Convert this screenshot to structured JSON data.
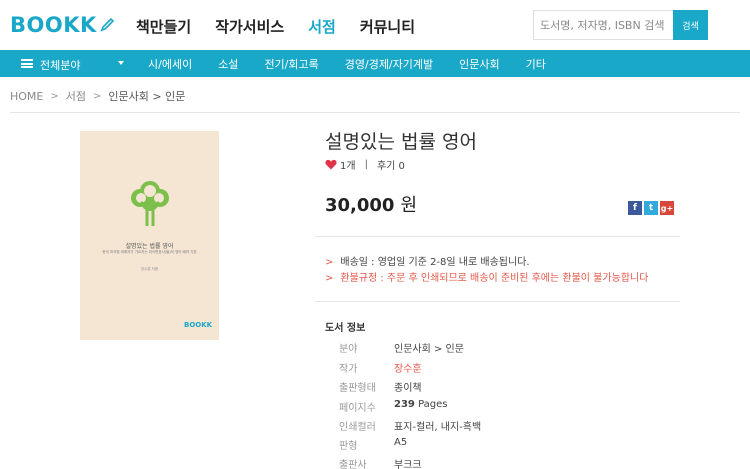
{
  "header": {
    "logo": "BOOKK",
    "nav": [
      "책만들기",
      "작가서비스",
      "서점",
      "커뮤니티"
    ],
    "active_nav": "서점",
    "search_placeholder": "도서명, 저자명, ISBN 검색",
    "search_button": "검색"
  },
  "category_bar": {
    "all_label": "전체분야",
    "items": [
      "시/에세이",
      "소설",
      "전기/회고록",
      "경영/경제/자기계발",
      "인문사회",
      "기타"
    ]
  },
  "breadcrumb": [
    "HOME",
    "서점",
    "인문사회 > 인문"
  ],
  "cover": {
    "title": "설명있는 법률 영어",
    "subtitle": "한국 미국법 외래자가 가르치는 미국변호사(들)의 영어 배려 기본",
    "author": "장수훈 지음",
    "logo": "BOOKK"
  },
  "product": {
    "title": "설명있는 법률 영어",
    "likes": "1개",
    "reviews": "후기 0",
    "price": "30,000",
    "currency": "원",
    "shipping": "배송일 : 영업일 기준 2-8일 내로 배송됩니다.",
    "refund": "환불규정 : 주문 후 인쇄되므로 배송이 준비된 후에는 환불이 불가능합니다"
  },
  "book_info": {
    "heading": "도서 정보",
    "rows": [
      {
        "key": "분야",
        "value": "인문사회 > 인문"
      },
      {
        "key": "작가",
        "value": "장수훈"
      },
      {
        "key": "출판형태",
        "value": "종이책"
      },
      {
        "key": "페이지수",
        "value": "239",
        "unit": "Pages"
      },
      {
        "key": "인쇄컬러",
        "value": "표지-컬러, 내지-흑백"
      },
      {
        "key": "판형",
        "value": "A5"
      },
      {
        "key": "출판사",
        "value": "부크크"
      }
    ]
  },
  "social": [
    "f",
    "t",
    "g+"
  ],
  "colors": {
    "brand": "#1aa8c8",
    "accent_red": "#e35a4a",
    "heart": "#e0334a",
    "cover_bg": "#f5e6d4",
    "tree": "#7cc04b"
  }
}
